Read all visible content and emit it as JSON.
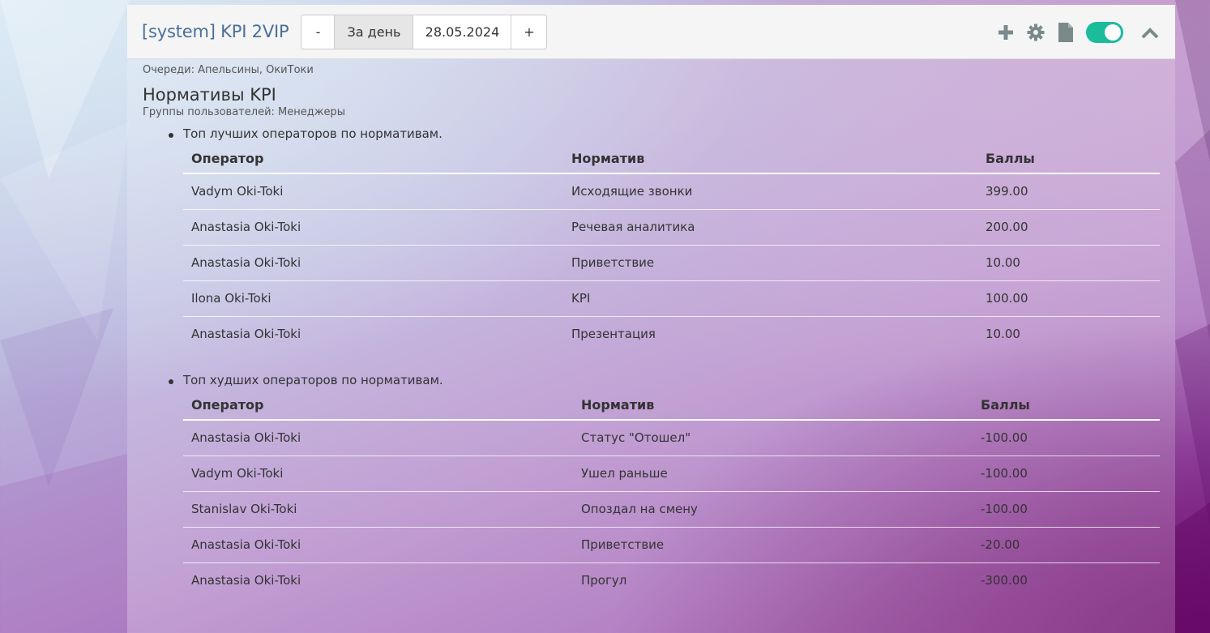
{
  "header": {
    "title": "[system] KPI 2VIP",
    "date_minus": "-",
    "period": "За день",
    "date": "28.05.2024",
    "date_plus": "+",
    "accent_color": "#1abc9c"
  },
  "body": {
    "queues": "Очереди: Апельсины, ОкиТоки",
    "section_title": "Нормативы KPI",
    "groups": "Группы пользователей: Менеджеры"
  },
  "best": {
    "label": "Топ лучших операторов по нормативам.",
    "headers": [
      "Оператор",
      "Норматив",
      "Баллы"
    ],
    "rows": [
      [
        "Vadym Oki-Toki",
        "Исходящие звонки",
        "399.00"
      ],
      [
        "Anastasia Oki-Toki",
        "Речевая аналитика",
        "200.00"
      ],
      [
        "Anastasia Oki-Toki",
        "Приветствие",
        "10.00"
      ],
      [
        "Ilona Oki-Toki",
        "KPI",
        "100.00"
      ],
      [
        "Anastasia Oki-Toki",
        "Презентация",
        "10.00"
      ]
    ]
  },
  "worst": {
    "label": "Топ худших операторов по нормативам.",
    "headers": [
      "Оператор",
      "Норматив",
      "Баллы"
    ],
    "rows": [
      [
        "Anastasia Oki-Toki",
        "Статус \"Отошел\"",
        "-100.00"
      ],
      [
        "Vadym Oki-Toki",
        "Ушел раньше",
        "-100.00"
      ],
      [
        "Stanislav Oki-Toki",
        "Опоздал на смену",
        "-100.00"
      ],
      [
        "Anastasia Oki-Toki",
        "Приветствие",
        "-20.00"
      ],
      [
        "Anastasia Oki-Toki",
        "Прогул",
        "-300.00"
      ]
    ]
  }
}
